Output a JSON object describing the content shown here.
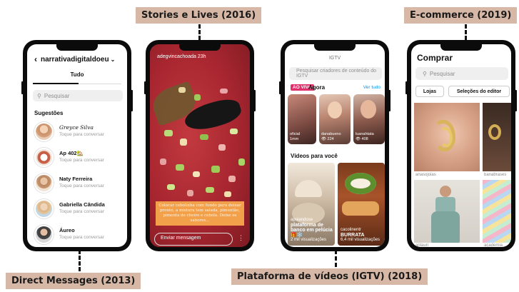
{
  "labels": {
    "direct": "Direct Messages (2013)",
    "stories": "Stories e Lives (2016)",
    "igtv": "Plataforma de vídeos (IGTV) (2018)",
    "ecommerce": "E-commerce (2019)"
  },
  "dm": {
    "username": "narrativadigitaldoeu",
    "tab": "Tudo",
    "search_placeholder": "Pesquisar",
    "suggestions_title": "Sugestões",
    "contacts": [
      {
        "name": "Greyce Silva",
        "sub": "Toque para conversar"
      },
      {
        "name": "Ap 402🏡",
        "sub": "Toque para conversar"
      },
      {
        "name": "Naty Ferreira",
        "sub": "Toque para conversar"
      },
      {
        "name": "Gabriella Cândida",
        "sub": "Toque para conversar"
      },
      {
        "name": "Áureo",
        "sub": "Toque para conversar"
      }
    ]
  },
  "stories": {
    "username": "adegvincachoada  23h",
    "caption": "Colocar cebolinha com fundo para deixar pronto, a mistura tem salada, pimentão, pimenta de cheiro e cebola. Deixe os sabores...",
    "message_placeholder": "Enviar mensagem"
  },
  "igtv": {
    "top": "IGTV",
    "search_placeholder": "Pesquisar criadores de conteúdo do IGTV",
    "live_badge": "AO VIVO",
    "agora": "Agora",
    "see_all": "Ver tudo",
    "live_tiles": [
      {
        "name": "oficial",
        "count": "1mm"
      },
      {
        "name": "danabueno",
        "count": "👁 224"
      },
      {
        "name": "luanahtata",
        "count": "👁 408"
      }
    ],
    "section_title": "Vídeos para você",
    "videos": [
      {
        "user": "apoiandose",
        "title": "plataforma de banco em pelúcia 🎁❄️",
        "views": "2 mil visualizações"
      },
      {
        "user": "cacolinentr",
        "title": "BURRATA",
        "views": "6,4 mil visualizações"
      }
    ]
  },
  "shop": {
    "title": "Comprar",
    "search_placeholder": "Pesquisar",
    "pill_stores": "Lojas",
    "pill_editors": "Seleções do editor",
    "items": [
      {
        "name": "anasojoias"
      },
      {
        "name": "banabrases"
      },
      {
        "name": "anlauri"
      },
      {
        "name": "academia"
      }
    ]
  },
  "colors": {
    "label_bg": "#d7b8a6",
    "phone": "#0b0b0b",
    "live": "#e1306c",
    "link": "#0095f6"
  }
}
